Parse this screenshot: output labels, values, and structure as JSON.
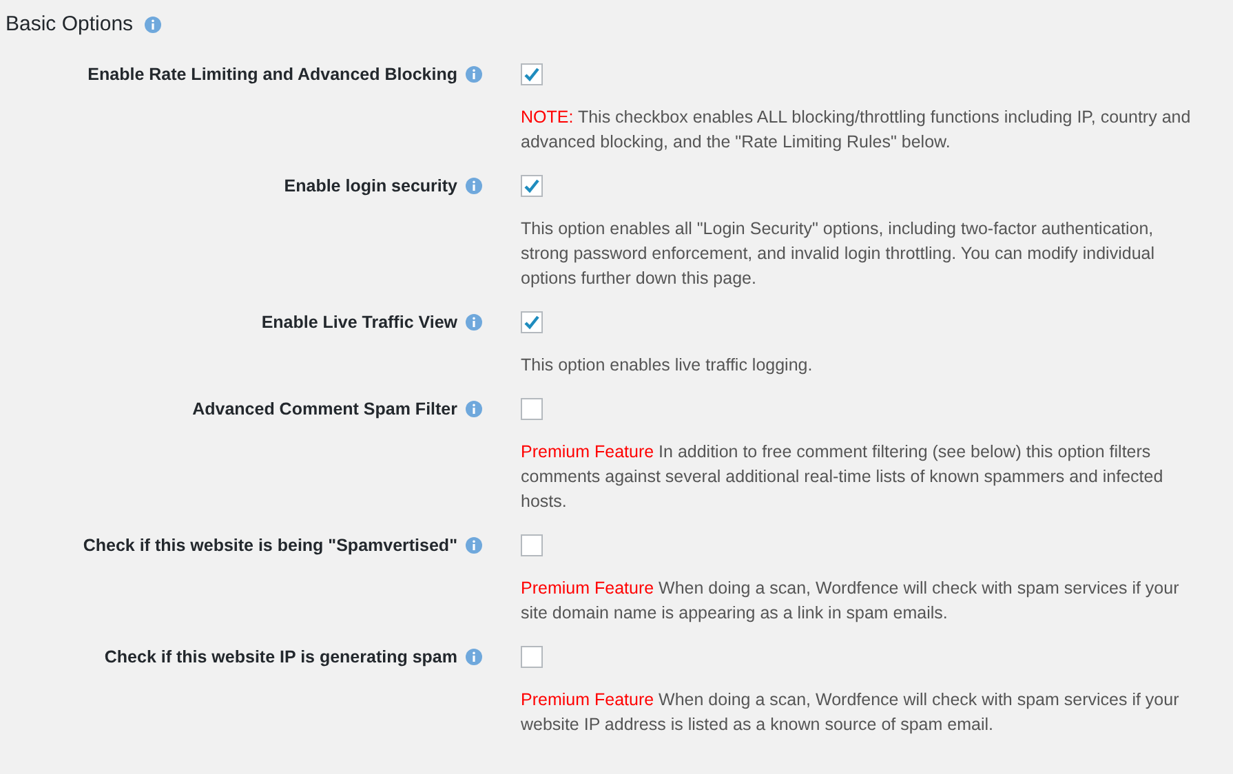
{
  "section": {
    "title": "Basic Options"
  },
  "options": [
    {
      "label": "Enable Rate Limiting and Advanced Blocking",
      "checked": true,
      "prefix": "NOTE:",
      "description": "This checkbox enables ALL blocking/throttling functions including IP, country and advanced blocking, and the \"Rate Limiting Rules\" below."
    },
    {
      "label": "Enable login security",
      "checked": true,
      "description": "This option enables all \"Login Security\" options, including two-factor authentication, strong password enforcement, and invalid login throttling. You can modify individual options further down this page."
    },
    {
      "label": "Enable Live Traffic View",
      "checked": true,
      "description": "This option enables live traffic logging."
    },
    {
      "label": "Advanced Comment Spam Filter",
      "checked": false,
      "prefix": "Premium Feature",
      "description": "In addition to free comment filtering (see below) this option filters comments against several additional real-time lists of known spammers and infected hosts."
    },
    {
      "label": "Check if this website is being \"Spamvertised\"",
      "checked": false,
      "prefix": "Premium Feature",
      "description": "When doing a scan, Wordfence will check with spam services if your site domain name is appearing as a link in spam emails."
    },
    {
      "label": "Check if this website IP is generating spam",
      "checked": false,
      "prefix": "Premium Feature",
      "description": "When doing a scan, Wordfence will check with spam services if your website IP address is listed as a known source of spam email."
    }
  ]
}
